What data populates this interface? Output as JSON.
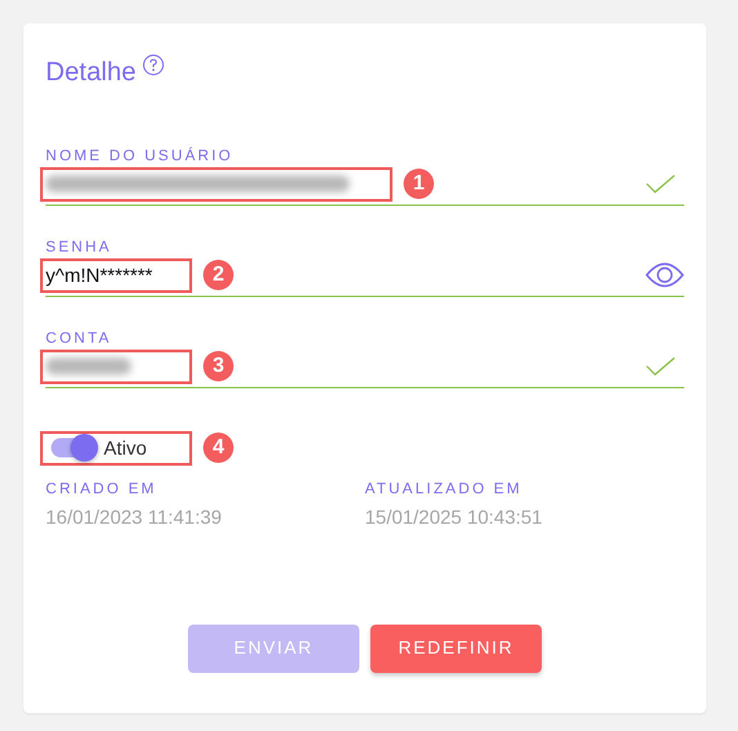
{
  "title": "Detalhe",
  "fields": [
    {
      "label": "NOME DO USUÁRIO",
      "kind": "check",
      "blurred": true,
      "callout": "1"
    },
    {
      "label": "SENHA",
      "kind": "eye",
      "value": "y^m!N*******",
      "callout": "2"
    },
    {
      "label": "CONTA",
      "kind": "check",
      "blurred": true,
      "callout": "3"
    }
  ],
  "toggle": {
    "label": "Ativo",
    "on": true,
    "callout": "4"
  },
  "dates": [
    {
      "label": "CRIADO EM",
      "value": "16/01/2023 11:41:39"
    },
    {
      "label": "ATUALIZADO EM",
      "value": "15/01/2025 10:43:51"
    }
  ],
  "buttons": [
    {
      "label": "ENVIAR",
      "kind": "submit",
      "disabled": true
    },
    {
      "label": "REDEFINIR",
      "kind": "reset",
      "disabled": false
    }
  ]
}
